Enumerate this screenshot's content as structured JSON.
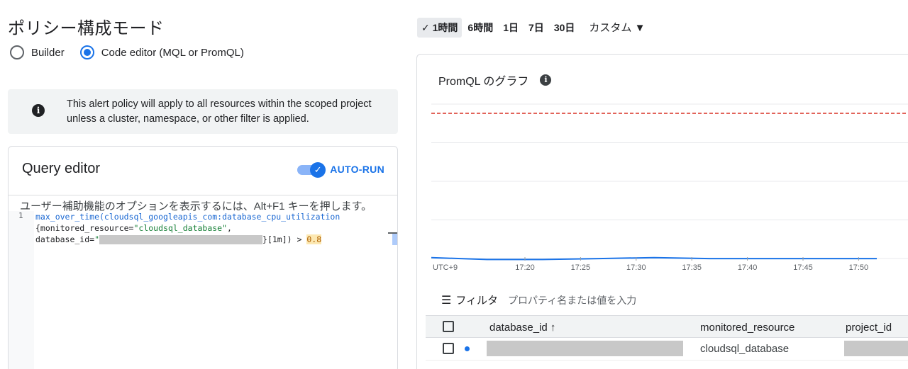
{
  "page": {
    "title": "ポリシー構成モード"
  },
  "mode_options": [
    {
      "label": "Builder",
      "selected": false
    },
    {
      "label": "Code editor (MQL or PromQL)",
      "selected": true
    }
  ],
  "info": {
    "icon": "info-icon",
    "text": "This alert policy will apply to all resources within the scoped project unless a cluster, namespace, or other filter is applied."
  },
  "query_editor": {
    "title": "Query editor",
    "autorun_label": "AUTO-RUN",
    "autorun_on": true,
    "a11y_hint": "ユーザー補助機能のオプションを表示するには、Alt+F1 キーを押します。",
    "line_number": "1",
    "code": {
      "line1": "max_over_time(cloudsql_googleapis_com:database_cpu_utilization",
      "line2_a": "{monitored_resource=",
      "line2_str": "\"cloudsql_database\"",
      "line2_b": ",",
      "line3_a": "database_id=",
      "line3_str": "\"",
      "line3_b": "}[1m]) > ",
      "threshold": "0.8"
    }
  },
  "time_range": {
    "options": [
      "1時間",
      "6時間",
      "1日",
      "7日",
      "30日"
    ],
    "active": "1時間",
    "custom_label": "カスタム",
    "check": "✓",
    "dropdown": "▼"
  },
  "graph": {
    "title": "PromQL のグラフ",
    "timezone": "UTC+9",
    "x_ticks": [
      "17:20",
      "17:25",
      "17:30",
      "17:35",
      "17:40",
      "17:45",
      "17:50"
    ],
    "threshold_color": "#d93025",
    "series_color": "#1a73e8"
  },
  "chart_data": {
    "type": "line",
    "x": [
      "17:16",
      "17:20",
      "17:25",
      "17:30",
      "17:35",
      "17:40",
      "17:45",
      "17:50",
      "17:55"
    ],
    "series": [
      {
        "values": [
          0.02,
          0.01,
          0.01,
          0.015,
          0.02,
          0.015,
          0.015,
          0.015,
          0.015
        ]
      }
    ],
    "threshold": 0.8,
    "ylim": [
      0,
      0.85
    ]
  },
  "filter": {
    "label": "フィルタ",
    "placeholder": "プロパティ名または値を入力"
  },
  "table": {
    "columns": [
      "database_id",
      "monitored_resource",
      "project_id"
    ],
    "sort_indicator": "↑",
    "rows": [
      {
        "monitored_resource": "cloudsql_database"
      }
    ]
  }
}
